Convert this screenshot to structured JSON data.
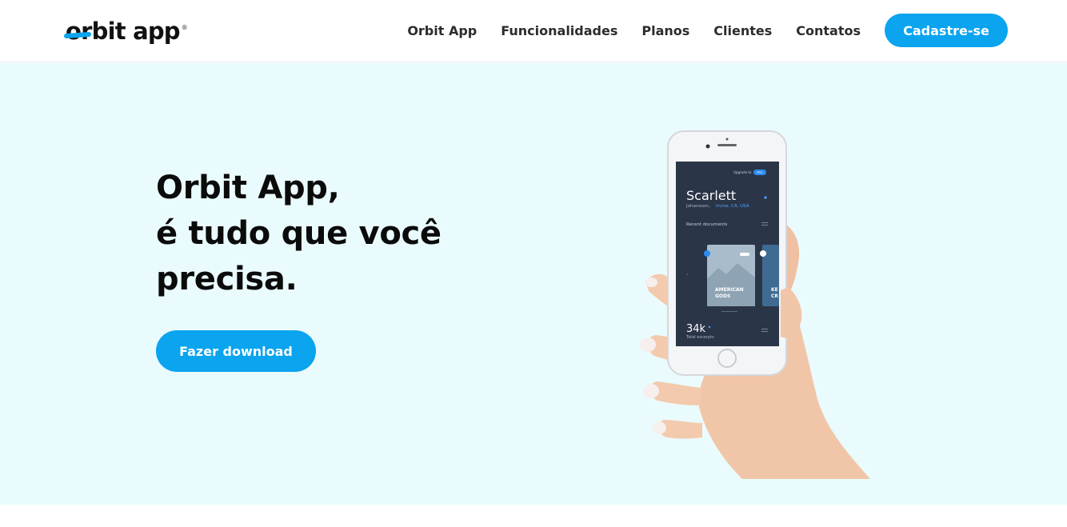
{
  "header": {
    "logo": {
      "text": "orbit app",
      "reg_mark": "®"
    },
    "nav": [
      {
        "label": "Orbit App"
      },
      {
        "label": "Funcionalidades"
      },
      {
        "label": "Planos"
      },
      {
        "label": "Clientes"
      },
      {
        "label": "Contatos"
      }
    ],
    "cta_label": "Cadastre-se"
  },
  "hero": {
    "title_lines": [
      "Orbit App,",
      "é tudo que você",
      "precisa."
    ],
    "download_label": "Fazer download",
    "phone_screen": {
      "upgrade_text": "Upgrade to",
      "upgrade_badge": "PRO",
      "name": "Scarlett",
      "subtitle_plain": "Johansson,",
      "subtitle_location": "Irvine, CA, USA",
      "recent_label": "Recent documents",
      "card_title_line1": "AMERICAN",
      "card_title_line2": "GODS",
      "card2_partial_line1": "KE",
      "card2_partial_line2": "CR",
      "stat_value": "34k",
      "stat_label": "Total excerpts"
    }
  },
  "colors": {
    "accent": "#0aa4ef",
    "hero_background": "#eafbfe",
    "phone_screen": "#2b3548"
  }
}
